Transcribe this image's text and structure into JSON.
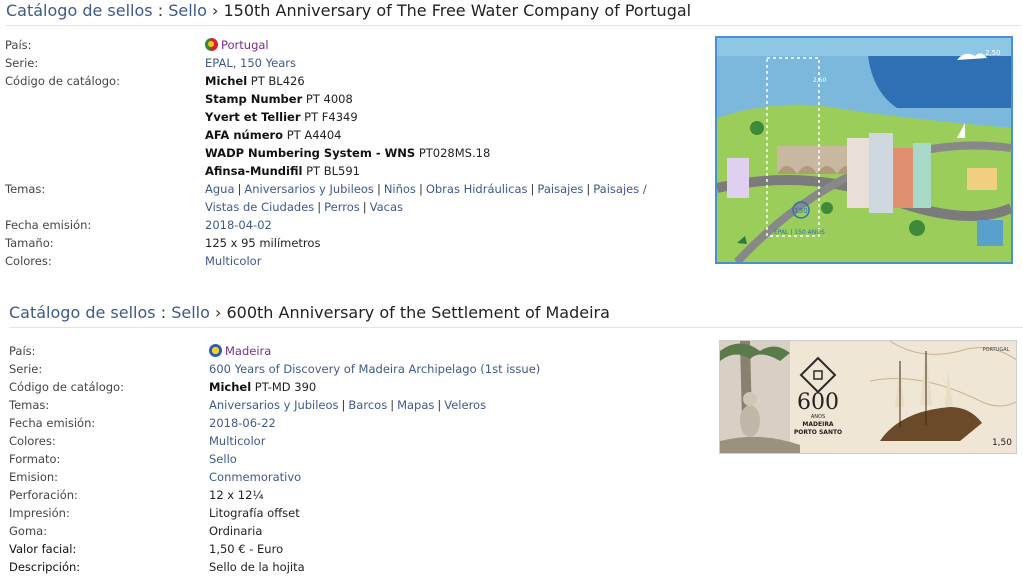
{
  "block1": {
    "breadcrumb": {
      "catalog": "Catálogo de sellos",
      "colon": ":",
      "item": "Sello",
      "arrow": "›",
      "title": "150th Anniversary of The Free Water Company of Portugal"
    },
    "pais": {
      "label": "País:",
      "value": "Portugal"
    },
    "serie": {
      "label": "Serie:",
      "value": "EPAL, 150 Years"
    },
    "codigo": {
      "label": "Código de catálogo:",
      "items": [
        {
          "name": "Michel",
          "code": "PT BL426"
        },
        {
          "name": "Stamp Number",
          "code": "PT 4008"
        },
        {
          "name": "Yvert et Tellier",
          "code": "PT F4349"
        },
        {
          "name": "AFA número",
          "code": "PT A4404"
        },
        {
          "name": "WADP Numbering System - WNS",
          "code": "PT028MS.18"
        },
        {
          "name": "Afinsa-Mundifil",
          "code": "PT BL591"
        }
      ]
    },
    "temas": {
      "label": "Temas:",
      "items": [
        "Agua",
        "Aniversarios y Jubileos",
        "Niños",
        "Obras Hidráulicas",
        "Paisajes",
        "Paisajes / Vistas de Ciudades",
        "Perros",
        "Vacas"
      ]
    },
    "fecha": {
      "label": "Fecha emisión:",
      "value": "2018-04-02"
    },
    "tamano": {
      "label": "Tamaño:",
      "value": "125 x 95 milímetros"
    },
    "colores": {
      "label": "Colores:",
      "value": "Multicolor"
    },
    "stamp": {
      "top_value": "2,50",
      "inner_value": "2,50",
      "label": "EPAL | 150 ANOS",
      "logo": "150"
    }
  },
  "block2": {
    "breadcrumb": {
      "catalog": "Catálogo de sellos",
      "colon": ":",
      "item": "Sello",
      "arrow": "›",
      "title": "600th Anniversary of the Settlement of Madeira"
    },
    "pais": {
      "label": "País:",
      "value": "Madeira"
    },
    "serie": {
      "label": "Serie:",
      "value": "600 Years of Discovery of Madeira Archipelago (1st issue)"
    },
    "codigo": {
      "label": "Código de catálogo:",
      "name": "Michel",
      "code": "PT-MD 390"
    },
    "temas": {
      "label": "Temas:",
      "items": [
        "Aniversarios y Jubileos",
        "Barcos",
        "Mapas",
        "Veleros"
      ]
    },
    "fecha": {
      "label": "Fecha emisión:",
      "value": "2018-06-22"
    },
    "colores": {
      "label": "Colores:",
      "value": "Multicolor"
    },
    "formato": {
      "label": "Formato:",
      "value": "Sello"
    },
    "emision": {
      "label": "Emision:",
      "value": "Conmemorativo"
    },
    "perforacion": {
      "label": "Perforación:",
      "value": "12 x 12¼"
    },
    "impresion": {
      "label": "Impresión:",
      "value": "Litografía offset"
    },
    "goma": {
      "label": "Goma:",
      "value": "Ordinaria"
    },
    "valor": {
      "label": "Valor facial:",
      "value": "1,50 € - Euro"
    },
    "descripcion": {
      "label": "Descripción:",
      "value": "Sello de la hojita"
    },
    "stamp": {
      "country": "PORTUGAL",
      "big_number": "600",
      "anos": "ANOS",
      "line1": "MADEIRA",
      "line2": "PORTO SANTO",
      "value": "1,50"
    }
  },
  "colors": {
    "link": "#3d5a8a",
    "country_link": "#7a2d8a",
    "stamp_border": "#4a8fcf"
  }
}
